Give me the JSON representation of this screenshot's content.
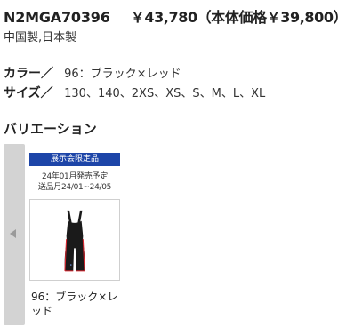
{
  "product": {
    "model": "N2MGA70396",
    "price_text": "￥43,780（本体価格￥39,800）",
    "origin": "中国製,日本製"
  },
  "specs": {
    "color_label": "カラー／",
    "color_value": "96：ブラック×レッド",
    "size_label": "サイズ／",
    "size_value": "130、140、2XS、XS、S、M、L、XL"
  },
  "variation": {
    "title": "バリエーション",
    "prev_icon": "chevron-left-icon",
    "items": [
      {
        "badge": "展示会限定品",
        "note_line1": "24年01月発売予定",
        "note_line2": "送品月24/01~24/05",
        "label": "96：ブラック×レッド",
        "colors": {
          "body": "#1a1a1a",
          "accent": "#d8262f",
          "badge": "#1d45a8"
        }
      }
    ]
  }
}
